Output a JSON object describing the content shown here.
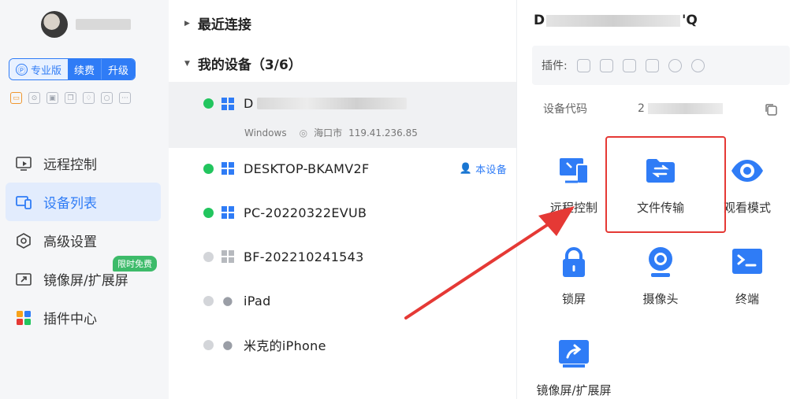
{
  "sidebar": {
    "edition": {
      "pro": "专业版",
      "pro_icon": "Ⓟ",
      "renew": "续费",
      "upgrade": "升级"
    },
    "mini_plugins": [
      "remote-icon",
      "gamepad-icon",
      "image-icon",
      "copy-icon",
      "bell-icon",
      "circle-icon",
      "more-icon"
    ],
    "nav": [
      {
        "label": "远程控制",
        "icon": "monitor-icon"
      },
      {
        "label": "设备列表",
        "icon": "devices-icon",
        "active": true
      },
      {
        "label": "高级设置",
        "icon": "settings-icon"
      },
      {
        "label": "镜像屏/扩展屏",
        "icon": "mirror-icon"
      },
      {
        "label": "插件中心",
        "icon": "plugin-center-icon"
      }
    ],
    "badge_free": "限时免费"
  },
  "devices": {
    "recent_group": "最近连接",
    "my_group": "我的设备（3/6）",
    "selected_prefix": "D",
    "selected_os": "Windows",
    "selected_location": "海口市",
    "selected_ip": "119.41.236.85",
    "this_device_label": "本设备",
    "list": [
      {
        "name": "DESKTOP-BKAMV2F",
        "online": true,
        "os": "windows"
      },
      {
        "name": "PC-20220322EVUB",
        "online": true,
        "os": "windows"
      },
      {
        "name": "BF-202210241543",
        "online": false,
        "os": "windows"
      },
      {
        "name": "iPad",
        "online": false,
        "os": "apple"
      },
      {
        "name": "米克的iPhone",
        "online": false,
        "os": "apple"
      }
    ]
  },
  "detail": {
    "title_start": "D",
    "title_end": "'Q",
    "plugins_label": "插件:",
    "code_label": "设备代码",
    "code_prefix": "2",
    "actions": [
      {
        "label": "远程控制",
        "icon": "remote-desktop-icon"
      },
      {
        "label": "文件传输",
        "icon": "file-transfer-icon"
      },
      {
        "label": "观看模式",
        "icon": "eye-icon"
      },
      {
        "label": "锁屏",
        "icon": "lock-icon"
      },
      {
        "label": "摄像头",
        "icon": "camera-icon"
      },
      {
        "label": "终端",
        "icon": "terminal-icon"
      },
      {
        "label": "镜像屏/扩展屏",
        "icon": "mirror-share-icon"
      }
    ]
  },
  "colors": {
    "accent": "#2f7cf6",
    "online": "#22c55e",
    "highlight": "#e53935"
  }
}
